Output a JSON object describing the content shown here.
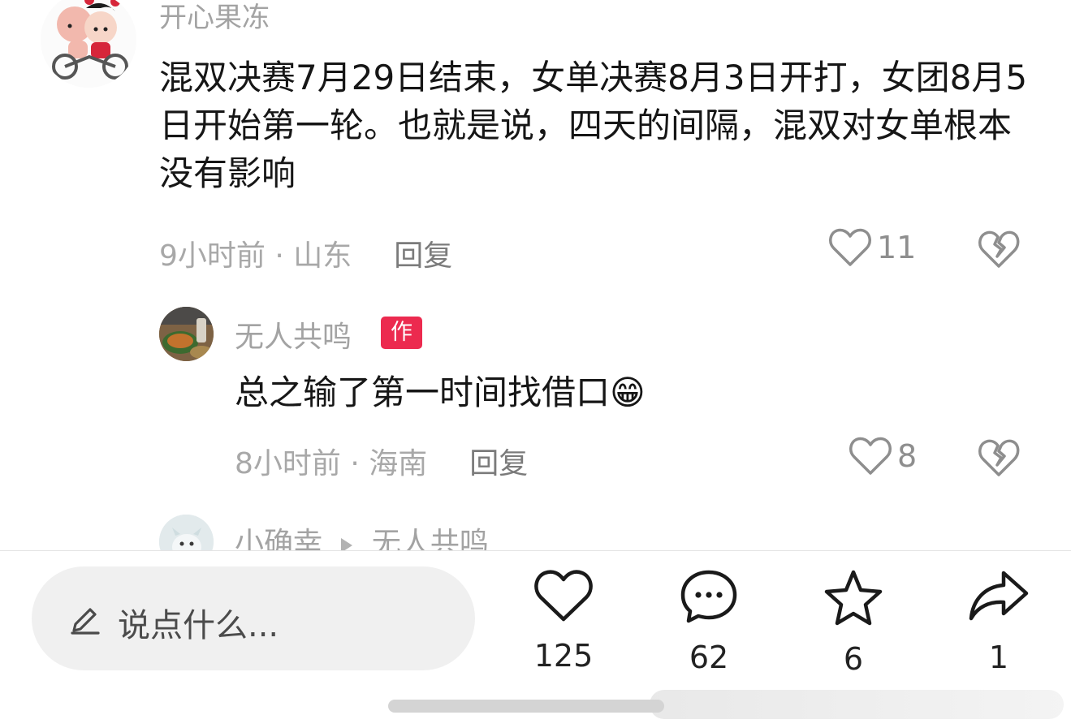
{
  "comments": [
    {
      "username": "开心果冻",
      "text": "混双决赛7月29日结束，女单决赛8月3日开打，女团8月5日开始第一轮。也就是说，四天的间隔，混双对女单根本没有影响",
      "time": "9小时前",
      "location": "山东",
      "reply_label": "回复",
      "likes": "11"
    },
    {
      "username": "无人共鸣",
      "badge": "作者",
      "text": "总之输了第一时间找借口😁",
      "time": "8小时前",
      "location": "海南",
      "reply_label": "回复",
      "likes": "8"
    },
    {
      "username": "小确幸",
      "reply_to": "无人共鸣"
    }
  ],
  "meta_separator": " · ",
  "bottom_bar": {
    "input_placeholder": "说点什么...",
    "actions": [
      {
        "name": "like",
        "icon": "heart-icon",
        "count": "125"
      },
      {
        "name": "comment",
        "icon": "comment-bubble-icon",
        "count": "62"
      },
      {
        "name": "favorite",
        "icon": "star-icon",
        "count": "6"
      },
      {
        "name": "share",
        "icon": "share-arrow-icon",
        "count": "1"
      }
    ]
  },
  "colors": {
    "badge": "#ec2a4f",
    "muted_text": "#a3a3a3",
    "body_text": "#161616",
    "pill_bg": "#f0f0f0"
  }
}
